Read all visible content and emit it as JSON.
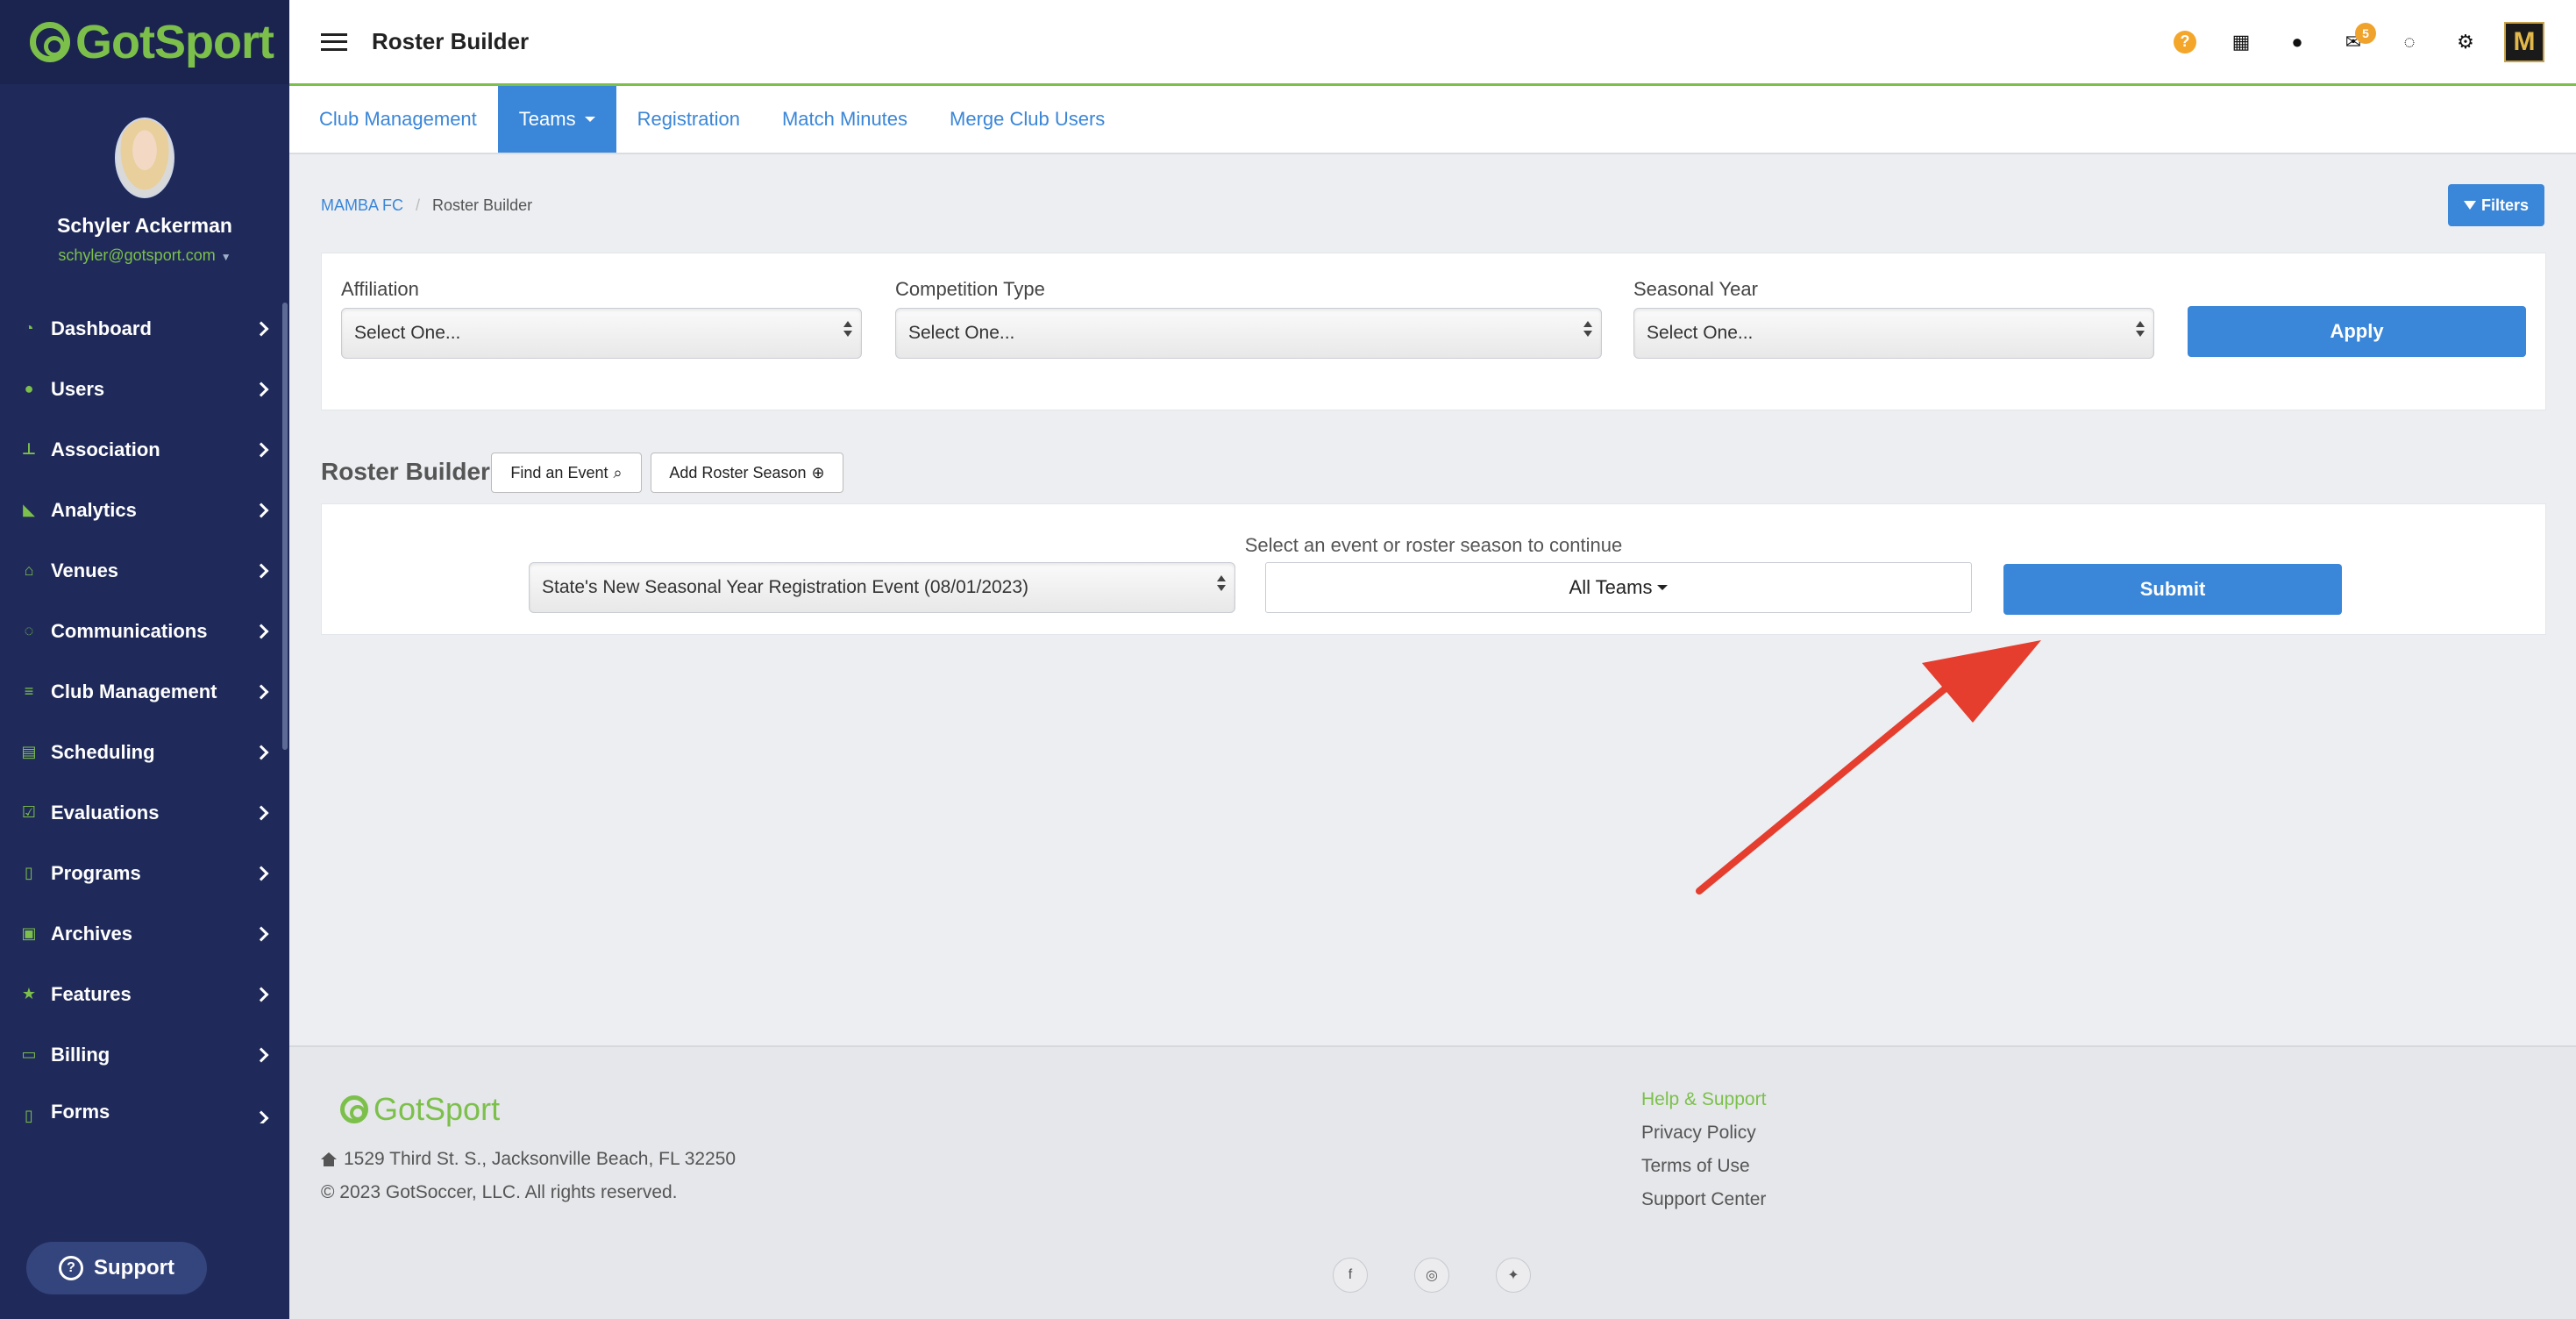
{
  "brand": {
    "name": "GotSport",
    "accent": "#7cc04b",
    "sidebar_bg": "#1f2a5a",
    "primary": "#3a86d8"
  },
  "user": {
    "name": "Schyler Ackerman",
    "email": "schyler@gotsport.com"
  },
  "sidebar": {
    "items": [
      {
        "label": "Dashboard",
        "icon": "dashboard-icon"
      },
      {
        "label": "Users",
        "icon": "users-icon"
      },
      {
        "label": "Association",
        "icon": "sitemap-icon"
      },
      {
        "label": "Analytics",
        "icon": "area-chart-icon"
      },
      {
        "label": "Venues",
        "icon": "home-icon"
      },
      {
        "label": "Communications",
        "icon": "comments-icon"
      },
      {
        "label": "Club Management",
        "icon": "tasks-icon"
      },
      {
        "label": "Scheduling",
        "icon": "calendar-list-icon"
      },
      {
        "label": "Evaluations",
        "icon": "calendar-check-icon"
      },
      {
        "label": "Programs",
        "icon": "file-icon"
      },
      {
        "label": "Archives",
        "icon": "archive-icon"
      },
      {
        "label": "Features",
        "icon": "star-icon"
      },
      {
        "label": "Billing",
        "icon": "credit-card-icon"
      },
      {
        "label": "Forms",
        "icon": "form-icon"
      }
    ],
    "support_label": "Support"
  },
  "topbar": {
    "title": "Roster Builder",
    "mail_badge": "5"
  },
  "tabs": [
    {
      "label": "Club Management",
      "active": false
    },
    {
      "label": "Teams",
      "active": true
    },
    {
      "label": "Registration",
      "active": false
    },
    {
      "label": "Match Minutes",
      "active": false
    },
    {
      "label": "Merge Club Users",
      "active": false
    }
  ],
  "breadcrumb": {
    "root": "MAMBA FC",
    "sep": "/",
    "current": "Roster Builder"
  },
  "filters_label": "Filters",
  "filter_form": {
    "affiliation": {
      "label": "Affiliation",
      "value": "Select One..."
    },
    "competition_type": {
      "label": "Competition Type",
      "value": "Select One..."
    },
    "seasonal_year": {
      "label": "Seasonal Year",
      "value": "Select One..."
    },
    "apply_label": "Apply"
  },
  "roster_builder": {
    "title": "Roster Builder",
    "find_event_label": "Find an Event",
    "add_roster_season_label": "Add Roster Season",
    "hint": "Select an event or roster season to continue",
    "event_value": "State's New Seasonal Year Registration Event (08/01/2023)",
    "teams_value": "All Teams",
    "submit_label": "Submit"
  },
  "footer": {
    "logo_text": "GotSport",
    "address": "1529 Third St. S., Jacksonville Beach, FL 32250",
    "copyright": "© 2023 GotSoccer, LLC. All rights reserved.",
    "links_heading": "Help & Support",
    "links": [
      "Privacy Policy",
      "Terms of Use",
      "Support Center"
    ],
    "social": [
      {
        "icon": "facebook-icon",
        "glyph": "f"
      },
      {
        "icon": "instagram-icon",
        "glyph": "◎"
      },
      {
        "icon": "twitter-icon",
        "glyph": "✦"
      }
    ]
  }
}
